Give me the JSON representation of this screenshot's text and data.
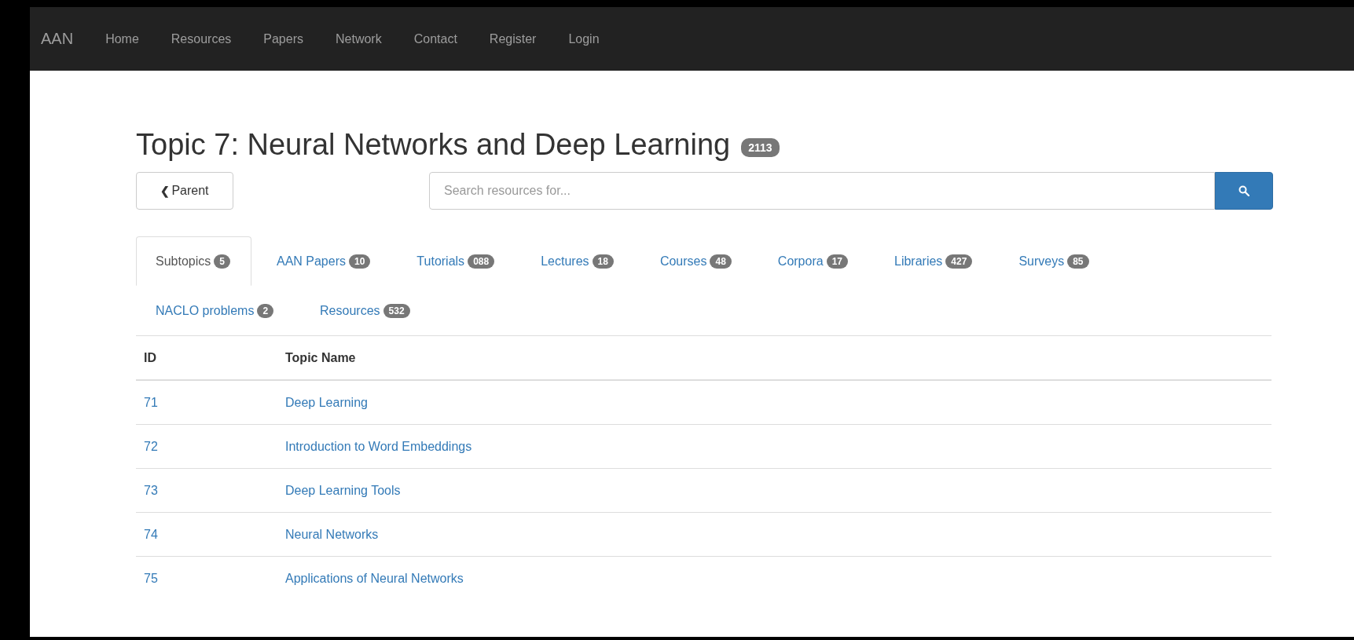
{
  "navbar": {
    "brand": "AAN",
    "links": [
      "Home",
      "Resources",
      "Papers",
      "Network",
      "Contact",
      "Register",
      "Login"
    ]
  },
  "heading": {
    "title": "Topic 7: Neural Networks and Deep Learning",
    "count": "2113"
  },
  "parent_button": {
    "icon": "❮",
    "label": "Parent"
  },
  "search": {
    "placeholder": "Search resources for..."
  },
  "tabs": [
    {
      "label": "Subtopics",
      "count": "5",
      "selected": true
    },
    {
      "label": "AAN Papers",
      "count": "10",
      "selected": false
    },
    {
      "label": "Tutorials",
      "count": "088",
      "selected": false
    },
    {
      "label": "Lectures",
      "count": "18",
      "selected": false
    },
    {
      "label": "Courses",
      "count": "48",
      "selected": false
    },
    {
      "label": "Corpora",
      "count": "17",
      "selected": false
    },
    {
      "label": "Libraries",
      "count": "427",
      "selected": false
    },
    {
      "label": "Surveys",
      "count": "85",
      "selected": false
    },
    {
      "label": "NACLO problems",
      "count": "2",
      "selected": false
    },
    {
      "label": "Resources",
      "count": "532",
      "selected": false
    }
  ],
  "table": {
    "columns": [
      "ID",
      "Topic Name"
    ],
    "rows": [
      [
        "71",
        "Deep Learning"
      ],
      [
        "72",
        "Introduction to Word Embeddings"
      ],
      [
        "73",
        "Deep Learning Tools"
      ],
      [
        "74",
        "Neural Networks"
      ],
      [
        "75",
        "Applications of Neural Networks"
      ]
    ]
  }
}
